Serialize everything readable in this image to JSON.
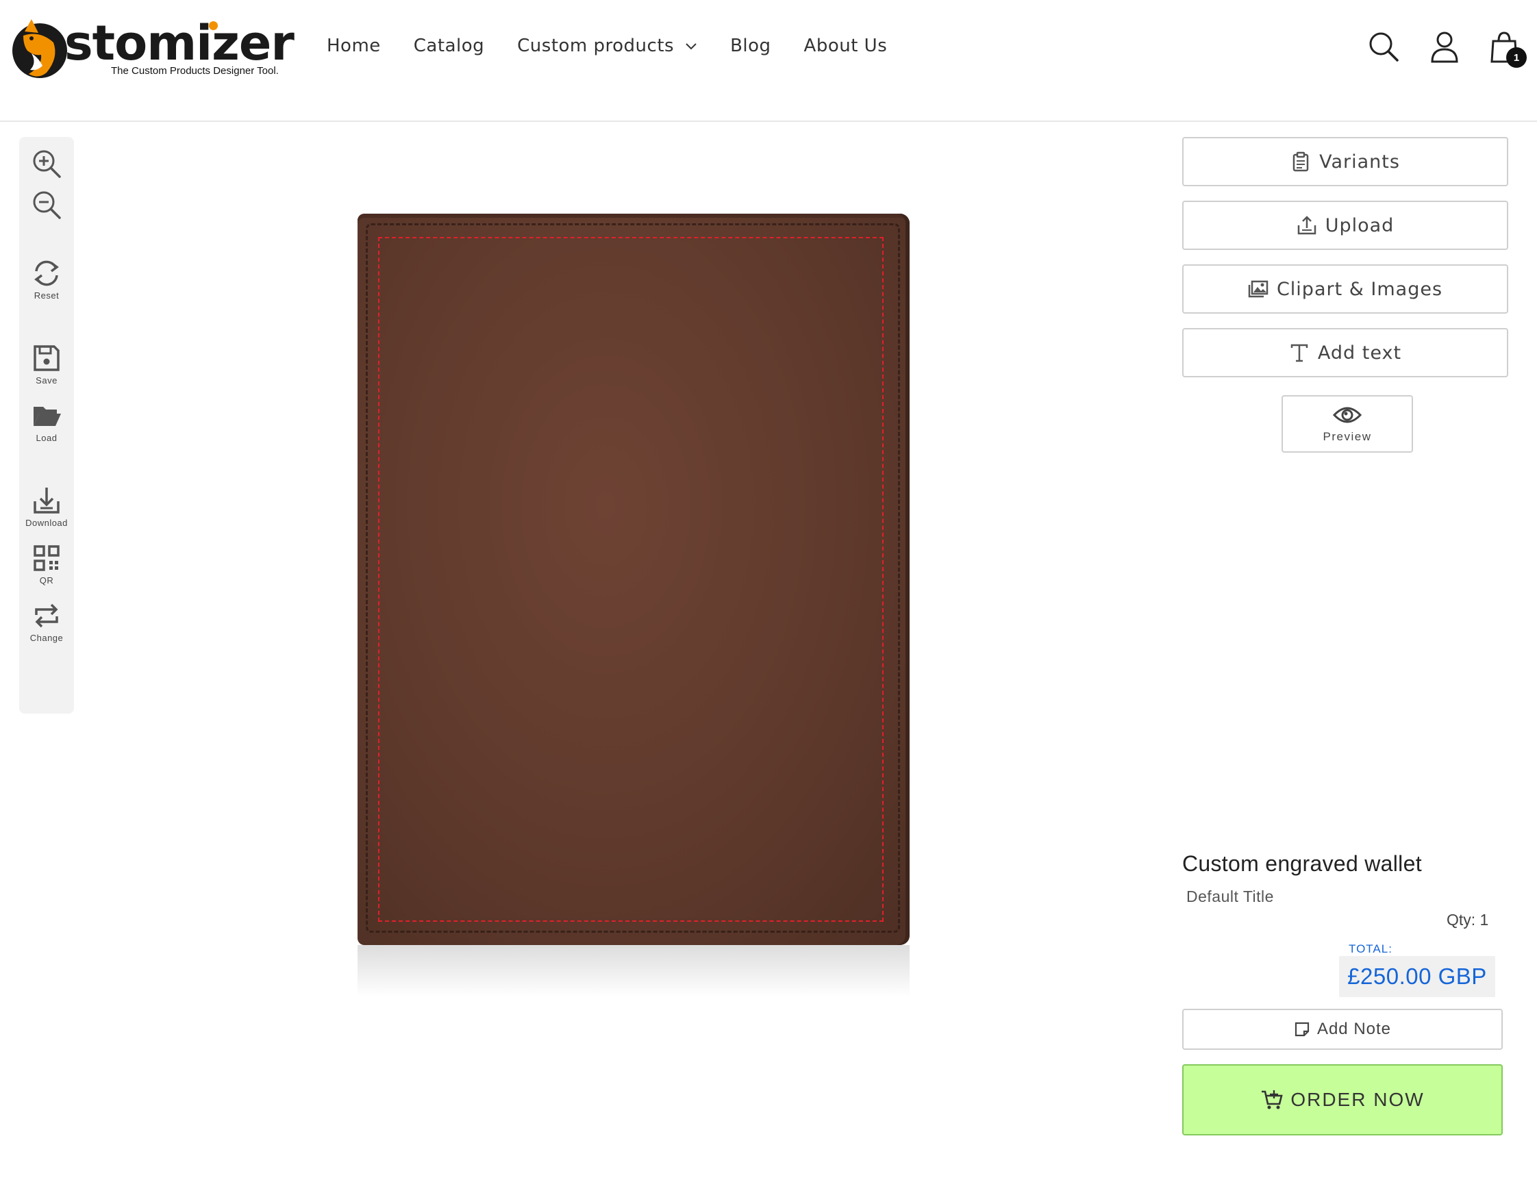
{
  "brand": {
    "wordmark": "stomizer",
    "tagline": "The Custom Products Designer Tool.",
    "accent_color": "#f29100"
  },
  "nav": {
    "items": [
      "Home",
      "Catalog",
      "Custom products",
      "Blog",
      "About Us"
    ]
  },
  "header_icons": [
    "search-icon",
    "account-icon",
    "cart-icon"
  ],
  "cart": {
    "count": "1"
  },
  "toolbar": {
    "zoom_in_icon": "zoom-in-icon",
    "zoom_out_icon": "zoom-out-icon",
    "reset": "Reset",
    "save": "Save",
    "load": "Load",
    "download": "Download",
    "qr": "QR",
    "change": "Change"
  },
  "panel": {
    "variants": "Variants",
    "upload": "Upload",
    "clipart": "Clipart & Images",
    "add_text": "Add text",
    "preview": "Preview"
  },
  "product": {
    "title": "Custom engraved wallet",
    "variant": "Default Title",
    "qty": "Qty: 1",
    "total_label": "TOTAL:",
    "total_value": "£250.00 GBP",
    "price_color": "#1565d8",
    "wallet_color": "#5f3a2c",
    "print_area_color": "#e0202a"
  },
  "actions": {
    "add_note": "Add Note",
    "order_now": "ORDER NOW",
    "order_color": "#c6fe9a"
  }
}
